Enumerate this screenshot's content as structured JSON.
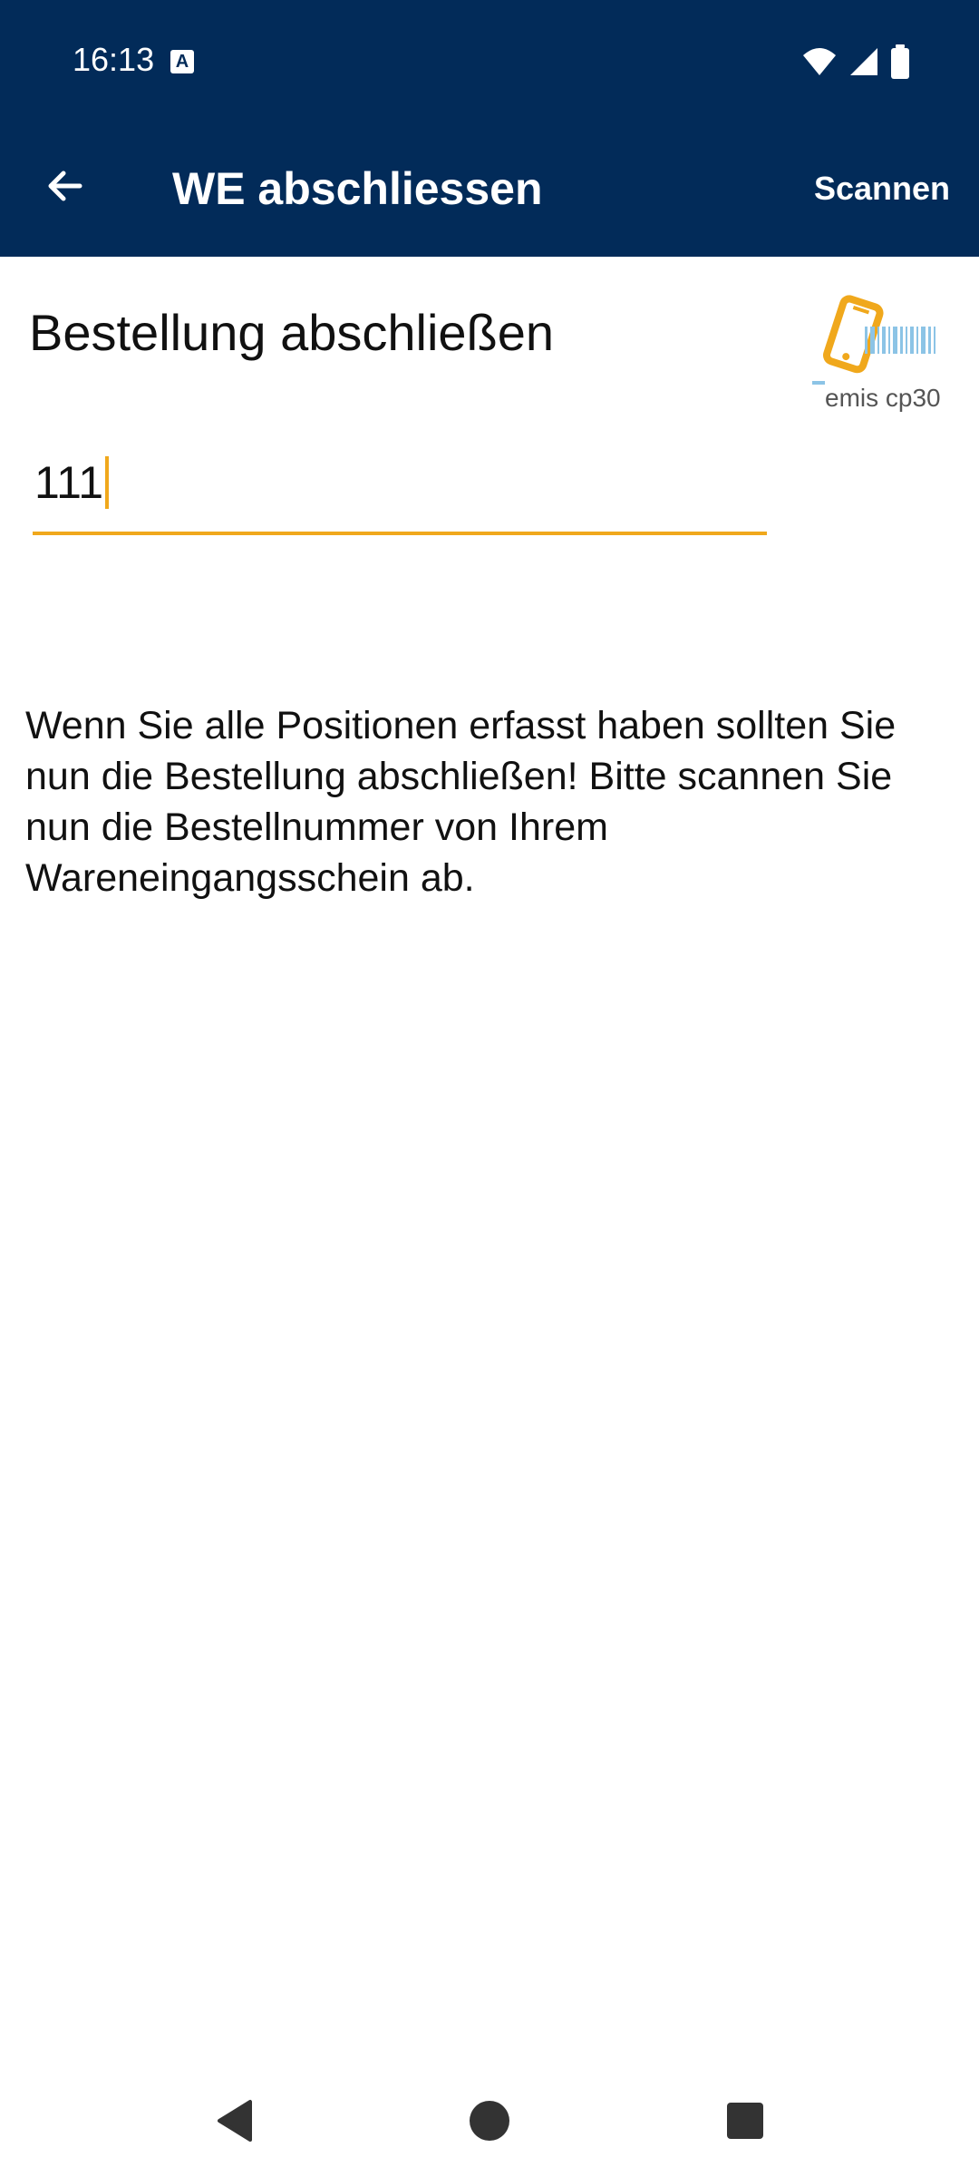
{
  "status_bar": {
    "time": "16:13",
    "notification_icon_letter": "A",
    "icons": [
      "wifi-icon",
      "signal-icon",
      "battery-icon"
    ]
  },
  "app_bar": {
    "title": "WE abschliessen",
    "back_icon": "arrow-left-icon",
    "scan_label": "Scannen",
    "background": "#022b59"
  },
  "main": {
    "heading": "Bestellung abschließen",
    "logo_text": "emis cp30",
    "order_input": {
      "value": "111",
      "accent": "#f0a81c"
    },
    "instructions": "Wenn Sie alle Positionen erfasst haben sollten Sie nun die Bestellung abschließen! Bitte scannen Sie nun die Bestellnummer von Ihrem Wareneingangsschein ab."
  },
  "nav_bar": {
    "buttons": [
      "back-triangle-icon",
      "home-circle-icon",
      "recents-square-icon"
    ]
  }
}
